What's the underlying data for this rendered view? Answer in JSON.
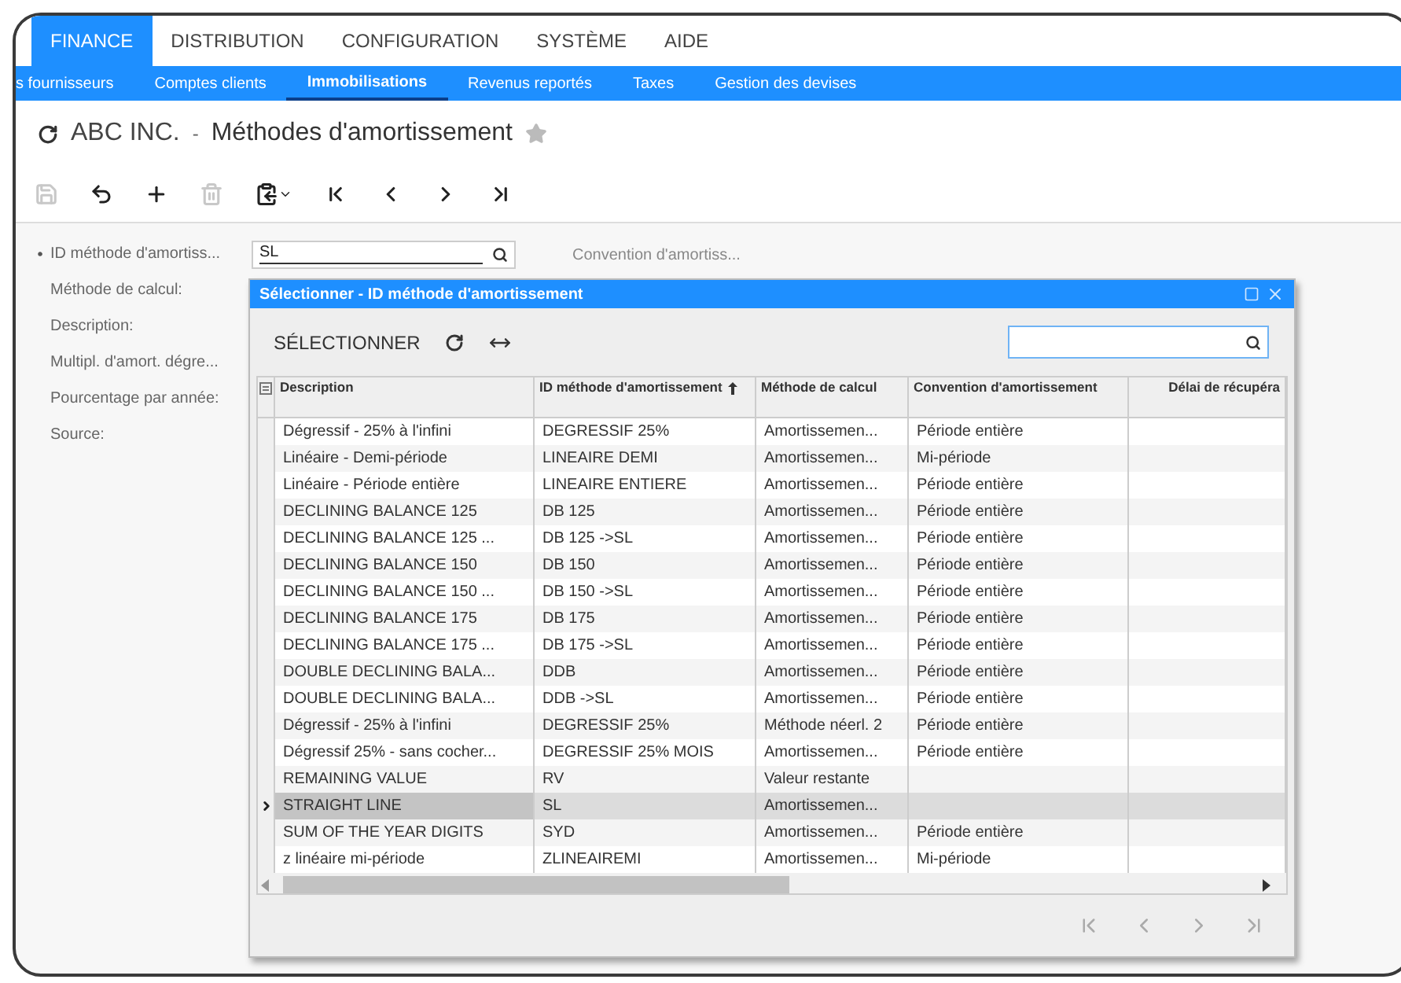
{
  "menu_tabs": [
    {
      "label": "FINANCE",
      "selected": true
    },
    {
      "label": "DISTRIBUTION",
      "selected": false
    },
    {
      "label": "CONFIGURATION",
      "selected": false
    },
    {
      "label": "SYSTÈME",
      "selected": false
    },
    {
      "label": "AIDE",
      "selected": false
    }
  ],
  "sub_tabs": [
    {
      "label": "s fournisseurs",
      "selected": false
    },
    {
      "label": "Comptes clients",
      "selected": false
    },
    {
      "label": "Immobilisations",
      "selected": true
    },
    {
      "label": "Revenus reportés",
      "selected": false
    },
    {
      "label": "Taxes",
      "selected": false
    },
    {
      "label": "Gestion des devises",
      "selected": false
    }
  ],
  "breadcrumb": {
    "company": "ABC INC.",
    "separator": "-",
    "title": "Méthodes d'amortissement",
    "favorite": false
  },
  "toolbar": [
    {
      "kind": "save",
      "disabled": true
    },
    {
      "kind": "undo",
      "disabled": false
    },
    {
      "kind": "add",
      "disabled": false
    },
    {
      "kind": "delete",
      "disabled": true
    },
    {
      "kind": "copy",
      "disabled": false
    },
    {
      "kind": "first",
      "disabled": false
    },
    {
      "kind": "previous",
      "disabled": false
    },
    {
      "kind": "next",
      "disabled": false
    },
    {
      "kind": "last",
      "disabled": false
    }
  ],
  "form": {
    "fields": [
      {
        "label": "ID méthode d'amortiss...",
        "required": true,
        "value": "SL"
      },
      {
        "label": "Méthode de calcul:",
        "required": false
      },
      {
        "label": "Description:",
        "required": false
      },
      {
        "label": "Multipl. d'amort. dégre...",
        "required": false
      },
      {
        "label": "Pourcentage par année:",
        "required": false
      },
      {
        "label": "Source:",
        "required": false
      }
    ],
    "right_label": "Convention d'amortiss..."
  },
  "dialog": {
    "title": "Sélectionner - ID méthode d'amortissement",
    "select_button": "SÉLECTIONNER",
    "columns": [
      {
        "label": "Description",
        "sorted": false
      },
      {
        "label": "ID méthode d'amortissement",
        "sorted": true
      },
      {
        "label": "Méthode de calcul",
        "sorted": false
      },
      {
        "label": "Convention d'amortissement",
        "sorted": false
      },
      {
        "label": "Délai de récupéra",
        "sorted": false
      }
    ],
    "rows": [
      {
        "description": "Dégressif - 25% à l'infini",
        "id": "DEGRESSIF 25%",
        "method": "Amortissemen...",
        "convention": "Période entière",
        "selected": false
      },
      {
        "description": "Linéaire - Demi-période",
        "id": "LINEAIRE DEMI",
        "method": "Amortissemen...",
        "convention": "Mi-période",
        "selected": false
      },
      {
        "description": "Linéaire - Période entière",
        "id": "LINEAIRE ENTIERE",
        "method": "Amortissemen...",
        "convention": "Période entière",
        "selected": false
      },
      {
        "description": "DECLINING BALANCE 125",
        "id": "DB 125",
        "method": "Amortissemen...",
        "convention": "Période entière",
        "selected": false
      },
      {
        "description": "DECLINING BALANCE 125 ...",
        "id": "DB 125 ->SL",
        "method": "Amortissemen...",
        "convention": "Période entière",
        "selected": false
      },
      {
        "description": "DECLINING BALANCE 150",
        "id": "DB 150",
        "method": "Amortissemen...",
        "convention": "Période entière",
        "selected": false
      },
      {
        "description": "DECLINING BALANCE 150 ...",
        "id": "DB 150 ->SL",
        "method": "Amortissemen...",
        "convention": "Période entière",
        "selected": false
      },
      {
        "description": "DECLINING BALANCE 175",
        "id": "DB 175",
        "method": "Amortissemen...",
        "convention": "Période entière",
        "selected": false
      },
      {
        "description": "DECLINING BALANCE 175 ...",
        "id": "DB 175 ->SL",
        "method": "Amortissemen...",
        "convention": "Période entière",
        "selected": false
      },
      {
        "description": "DOUBLE DECLINING BALA...",
        "id": "DDB",
        "method": "Amortissemen...",
        "convention": "Période entière",
        "selected": false
      },
      {
        "description": "DOUBLE DECLINING BALA...",
        "id": "DDB ->SL",
        "method": "Amortissemen...",
        "convention": "Période entière",
        "selected": false
      },
      {
        "description": "Dégressif - 25% à l'infini",
        "id": "DEGRESSIF 25%",
        "method": "Méthode néerl. 2",
        "convention": "Période entière",
        "selected": false
      },
      {
        "description": "Dégressif 25% - sans cocher...",
        "id": "DEGRESSIF 25% MOIS",
        "method": "Amortissemen...",
        "convention": "Période entière",
        "selected": false
      },
      {
        "description": "REMAINING VALUE",
        "id": "RV",
        "method": "Valeur restante",
        "selected": false
      },
      {
        "description": "STRAIGHT LINE",
        "id": "SL",
        "method": "Amortissemen...",
        "selected": true
      },
      {
        "description": "SUM OF THE YEAR DIGITS",
        "id": "SYD",
        "method": "Amortissemen...",
        "convention": "Période entière",
        "selected": false
      },
      {
        "description": "z linéaire mi-période",
        "id": "ZLINEAIREMI",
        "method": "Amortissemen...",
        "convention": "Mi-période",
        "selected": false
      }
    ],
    "pager": [
      {
        "kind": "first",
        "disabled": true
      },
      {
        "kind": "previous",
        "disabled": true
      },
      {
        "kind": "next",
        "disabled": true
      },
      {
        "kind": "last",
        "disabled": true
      }
    ]
  }
}
